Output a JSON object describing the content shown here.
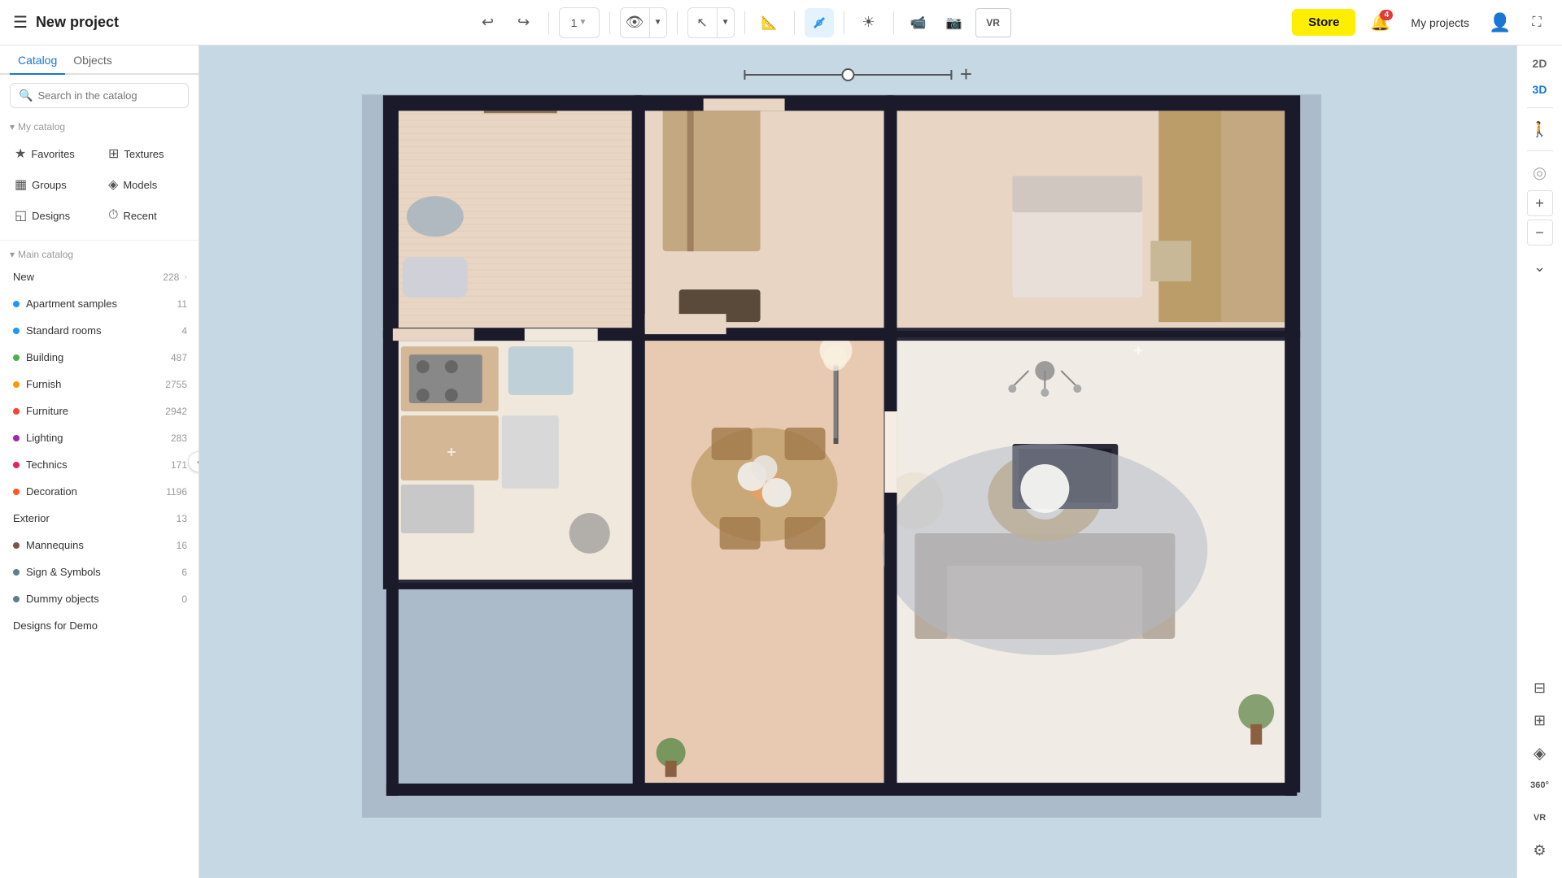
{
  "app": {
    "title": "New project",
    "hamburger": "☰",
    "expand_icon": "⛶"
  },
  "toolbar": {
    "undo_label": "↩",
    "redo_label": "↪",
    "step_label": "1",
    "view_label": "👁",
    "cursor_label": "↖",
    "ruler_label": "📏",
    "draw_label": "✏️",
    "sun_label": "☀",
    "camera_label": "🎥",
    "screenshot_label": "📷",
    "vr_label": "VR",
    "store_label": "Store",
    "notification_count": "4",
    "my_projects_label": "My projects"
  },
  "tabs": [
    {
      "id": "catalog",
      "label": "Catalog",
      "active": true
    },
    {
      "id": "objects",
      "label": "Objects",
      "active": false
    }
  ],
  "search": {
    "placeholder": "Search in the catalog"
  },
  "my_catalog": {
    "header": "My catalog",
    "items": [
      {
        "id": "favorites",
        "icon": "★",
        "label": "Favorites"
      },
      {
        "id": "textures",
        "icon": "⬛",
        "label": "Textures"
      },
      {
        "id": "groups",
        "icon": "▦",
        "label": "Groups"
      },
      {
        "id": "models",
        "icon": "◈",
        "label": "Models"
      },
      {
        "id": "designs",
        "icon": "◱",
        "label": "Designs"
      },
      {
        "id": "recent",
        "icon": "🕐",
        "label": "Recent"
      }
    ]
  },
  "main_catalog": {
    "header": "Main catalog",
    "items": [
      {
        "id": "new",
        "label": "New",
        "count": "228",
        "dot_color": null,
        "has_dot": false
      },
      {
        "id": "apartment_samples",
        "label": "Apartment samples",
        "count": "11",
        "dot_color": "#2196f3",
        "has_dot": true
      },
      {
        "id": "standard_rooms",
        "label": "Standard rooms",
        "count": "4",
        "dot_color": "#2196f3",
        "has_dot": true
      },
      {
        "id": "building",
        "label": "Building",
        "count": "487",
        "dot_color": "#4caf50",
        "has_dot": true
      },
      {
        "id": "furnish",
        "label": "Furnish",
        "count": "2755",
        "dot_color": "#ff9800",
        "has_dot": true
      },
      {
        "id": "furniture",
        "label": "Furniture",
        "count": "2942",
        "dot_color": "#f44336",
        "has_dot": true
      },
      {
        "id": "lighting",
        "label": "Lighting",
        "count": "283",
        "dot_color": "#9c27b0",
        "has_dot": true
      },
      {
        "id": "technics",
        "label": "Technics",
        "count": "171",
        "dot_color": "#e91e63",
        "has_dot": true
      },
      {
        "id": "decoration",
        "label": "Decoration",
        "count": "1196",
        "dot_color": "#ff5722",
        "has_dot": true
      },
      {
        "id": "exterior",
        "label": "Exterior",
        "count": "13",
        "dot_color": null,
        "has_dot": false
      },
      {
        "id": "mannequins",
        "label": "Mannequins",
        "count": "16",
        "dot_color": "#795548",
        "has_dot": true
      },
      {
        "id": "sign_symbols",
        "label": "Sign & Symbols",
        "count": "6",
        "dot_color": "#607d8b",
        "has_dot": true
      },
      {
        "id": "dummy_objects",
        "label": "Dummy objects",
        "count": "0",
        "dot_color": "#607d8b",
        "has_dot": true
      },
      {
        "id": "designs_demo",
        "label": "Designs for Demo",
        "count": "",
        "dot_color": null,
        "has_dot": false
      }
    ]
  },
  "right_panel": {
    "view_2d": "2D",
    "view_3d": "3D",
    "tools": [
      {
        "id": "walk",
        "icon": "🚶",
        "label": "walk-icon"
      },
      {
        "id": "compass",
        "icon": "◎",
        "label": "compass-icon"
      },
      {
        "id": "zoom_in",
        "icon": "+",
        "label": "zoom-in-icon"
      },
      {
        "id": "zoom_out",
        "icon": "−",
        "label": "zoom-out-icon"
      },
      {
        "id": "chevron_down",
        "icon": "⌄",
        "label": "chevron-down-icon"
      }
    ],
    "bottom_tools": [
      {
        "id": "floor_plan",
        "icon": "⊟",
        "label": "floor-plan-icon"
      },
      {
        "id": "elevation",
        "icon": "⊞",
        "label": "elevation-icon"
      },
      {
        "id": "tour",
        "icon": "◈",
        "label": "tour-icon"
      },
      {
        "id": "view_360",
        "icon": "360°",
        "label": "360-icon"
      },
      {
        "id": "vr_view",
        "icon": "VR",
        "label": "vr-view-icon"
      },
      {
        "id": "settings",
        "icon": "⚙",
        "label": "settings-icon"
      }
    ]
  }
}
